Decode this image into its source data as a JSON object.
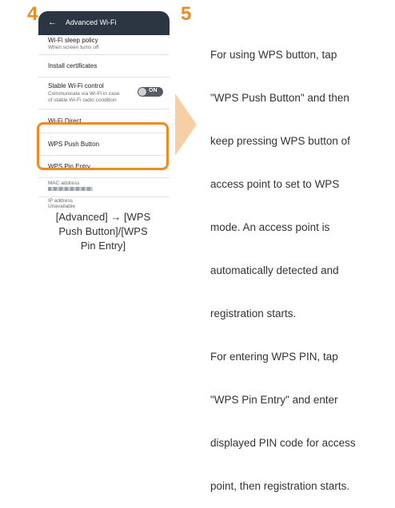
{
  "steps": {
    "step4": "4",
    "step5": "5"
  },
  "phone": {
    "header": {
      "back_icon": "arrow-left",
      "title": "Advanced Wi-Fi"
    },
    "items": [
      {
        "title": "Wi-Fi sleep policy",
        "subtitle": "When screen turns off"
      },
      {
        "title": "Install certificates"
      },
      {
        "title": "Stable Wi-Fi control",
        "subtitle_line1": "Communicate via Wi-Fi in case",
        "subtitle_line2": "of stable Wi-Fi radio condition",
        "toggle": "ON"
      },
      {
        "title": "Wi-Fi Direct"
      },
      {
        "title": "WPS Push Button"
      },
      {
        "title": "WPS Pin Entry"
      },
      {
        "title": "MAC address"
      },
      {
        "title": "IP address",
        "subtitle": "Unavailable"
      }
    ]
  },
  "caption": {
    "line1": "[Advanced] → [WPS",
    "line2": "Push Button]/[WPS",
    "line3": "Pin Entry]"
  },
  "description": [
    "For using WPS button, tap",
    "\"WPS Push Button\" and then",
    "keep pressing WPS button of",
    "access point to set to WPS",
    "mode. An access point is",
    "automatically detected and",
    "registration starts.",
    "For entering WPS PIN, tap",
    "\"WPS Pin Entry\" and enter",
    "displayed PIN code for access",
    "point, then registration starts."
  ],
  "colors": {
    "accent": "#ee8a1f",
    "header_bg": "#2b3642",
    "arrow": "#f6cfa5"
  }
}
